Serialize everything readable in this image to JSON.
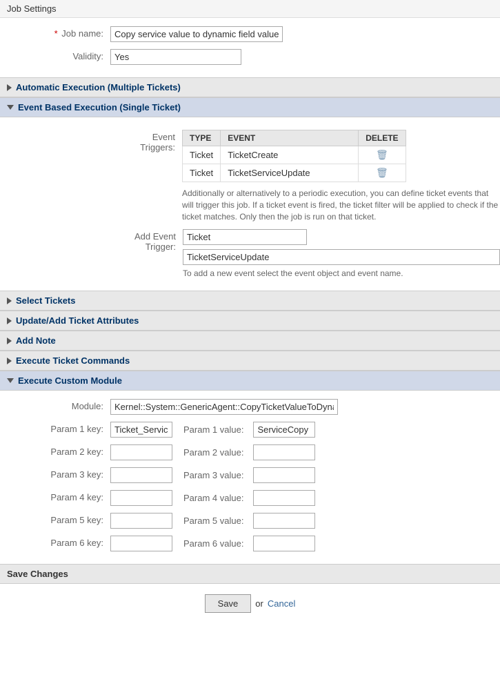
{
  "jobSettings": {
    "header": "Job Settings",
    "jobNameLabel": "Job name:",
    "jobNameValue": "Copy service value to dynamic field value",
    "validityLabel": "Validity:",
    "validityValue": "Yes",
    "requiredStar": "*"
  },
  "automaticExecution": {
    "label": "Automatic Execution (Multiple Tickets)",
    "state": "collapsed"
  },
  "eventBasedExecution": {
    "label": "Event Based Execution (Single Ticket)",
    "state": "expanded",
    "eventTriggersLabel": "Event Triggers:",
    "tableHeaders": {
      "type": "TYPE",
      "event": "EVENT",
      "delete": "DELETE"
    },
    "rows": [
      {
        "type": "Ticket",
        "event": "TicketCreate"
      },
      {
        "type": "Ticket",
        "event": "TicketServiceUpdate"
      }
    ],
    "description": "Additionally or alternatively to a periodic execution, you can define ticket events that will trigger this job. If a ticket event is fired, the ticket filter will be applied to check if the ticket matches. Only then the job is run on that ticket.",
    "addEventTriggerLabel": "Add Event Trigger:",
    "eventObjectValue": "Ticket",
    "eventNameValue": "TicketServiceUpdate",
    "addEventHint": "To add a new event select the event object and event name."
  },
  "selectTickets": {
    "label": "Select Tickets",
    "state": "collapsed"
  },
  "updateAddTicketAttributes": {
    "label": "Update/Add Ticket Attributes",
    "state": "collapsed"
  },
  "addNote": {
    "label": "Add Note",
    "state": "collapsed"
  },
  "executeTicketCommands": {
    "label": "Execute Ticket Commands",
    "state": "collapsed"
  },
  "executeCustomModule": {
    "label": "Execute Custom Module",
    "state": "expanded",
    "moduleLabel": "Module:",
    "moduleValue": "Kernel::System::GenericAgent::CopyTicketValueToDynamicF",
    "params": [
      {
        "keyLabel": "Param 1 key:",
        "keyValue": "Ticket_Service",
        "valueLabel": "Param 1 value:",
        "valueValue": "ServiceCopy"
      },
      {
        "keyLabel": "Param 2 key:",
        "keyValue": "",
        "valueLabel": "Param 2 value:",
        "valueValue": ""
      },
      {
        "keyLabel": "Param 3 key:",
        "keyValue": "",
        "valueLabel": "Param 3 value:",
        "valueValue": ""
      },
      {
        "keyLabel": "Param 4 key:",
        "keyValue": "",
        "valueLabel": "Param 4 value:",
        "valueValue": ""
      },
      {
        "keyLabel": "Param 5 key:",
        "keyValue": "",
        "valueLabel": "Param 5 value:",
        "valueValue": ""
      },
      {
        "keyLabel": "Param 6 key:",
        "keyValue": "",
        "valueLabel": "Param 6 value:",
        "valueValue": ""
      }
    ]
  },
  "saveSection": {
    "label": "Save Changes",
    "saveButton": "Save",
    "orText": "or",
    "cancelLink": "Cancel"
  }
}
